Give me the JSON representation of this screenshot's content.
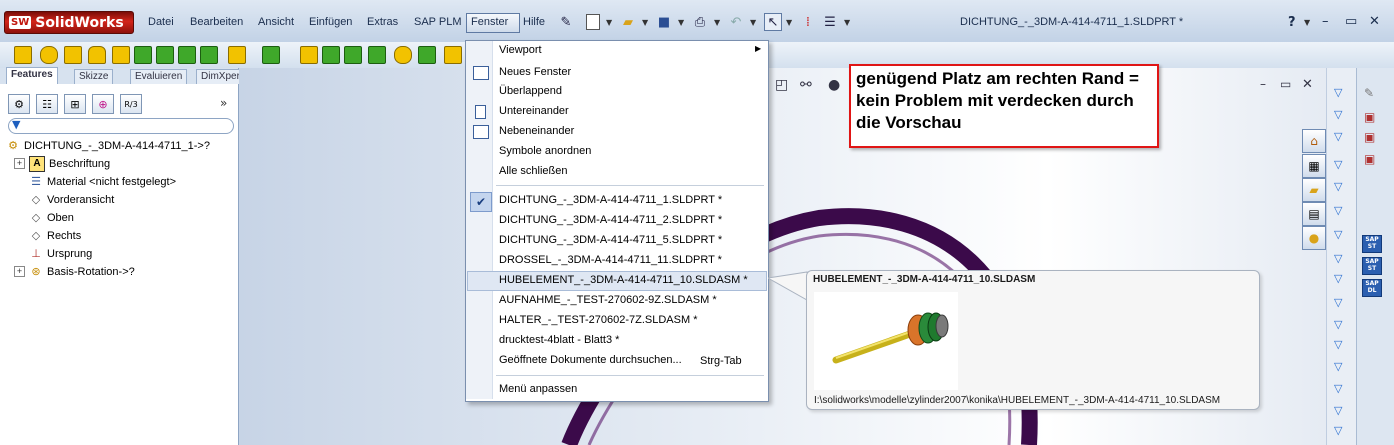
{
  "app": {
    "logo_text": "SolidWorks",
    "logo_badge": "SW"
  },
  "menubar": {
    "items": [
      "Datei",
      "Bearbeiten",
      "Ansicht",
      "Einfügen",
      "Extras",
      "SAP PLM",
      "Fenster",
      "Hilfe"
    ]
  },
  "document_title": "DICHTUNG_-_3DM-A-414-4711_1.SLDPRT *",
  "help_label": "?",
  "feature_tabs": [
    "Features",
    "Skizze",
    "Evaluieren",
    "DimXpert"
  ],
  "feature_tree": {
    "root": "DICHTUNG_-_3DM-A-414-4711_1->?",
    "items": [
      {
        "label": "Beschriftung",
        "expandable": true,
        "icon": "annotation-icon"
      },
      {
        "label": "Material <nicht festgelegt>",
        "expandable": false,
        "icon": "material-icon"
      },
      {
        "label": "Vorderansicht",
        "expandable": false,
        "icon": "plane-icon"
      },
      {
        "label": "Oben",
        "expandable": false,
        "icon": "plane-icon"
      },
      {
        "label": "Rechts",
        "expandable": false,
        "icon": "plane-icon"
      },
      {
        "label": "Ursprung",
        "expandable": false,
        "icon": "origin-icon"
      },
      {
        "label": "Basis-Rotation->?",
        "expandable": true,
        "icon": "revolve-icon"
      }
    ]
  },
  "fenster_menu": {
    "viewport": "Viewport",
    "window_commands": [
      "Neues Fenster",
      "Überlappend",
      "Untereinander",
      "Nebeneinander",
      "Symbole anordnen",
      "Alle schließen"
    ],
    "documents": [
      "DICHTUNG_-_3DM-A-414-4711_1.SLDPRT *",
      "DICHTUNG_-_3DM-A-414-4711_2.SLDPRT *",
      "DICHTUNG_-_3DM-A-414-4711_5.SLDPRT *",
      "DROSSEL_-_3DM-A-414-4711_11.SLDPRT *",
      "HUBELEMENT_-_3DM-A-414-4711_10.SLDASM *",
      "AUFNAHME_-_TEST-270602-9Z.SLDASM *",
      "HALTER_-_TEST-270602-7Z.SLDASM *",
      "drucktest-4blatt - Blatt3 *"
    ],
    "browse": "Geöffnete Dokumente durchsuchen...",
    "browse_shortcut": "Strg-Tab",
    "customize": "Menü anpassen"
  },
  "preview": {
    "title": "HUBELEMENT_-_3DM-A-414-4711_10.SLDASM",
    "path": "I:\\solidworks\\modelle\\zylinder2007\\konika\\HUBELEMENT_-_3DM-A-414-4711_10.SLDASM"
  },
  "callout": {
    "text": "genügend Platz am rechten Rand = kein Problem mit verdecken durch die Vorschau"
  },
  "sap_badges": [
    [
      "SAP",
      "ST"
    ],
    [
      "SAP",
      "ST"
    ],
    [
      "SAP",
      "DL"
    ]
  ],
  "colors": {
    "callout_border": "#e01515",
    "logo_red": "#d3241a",
    "model_purple": "#3b0a4a"
  }
}
